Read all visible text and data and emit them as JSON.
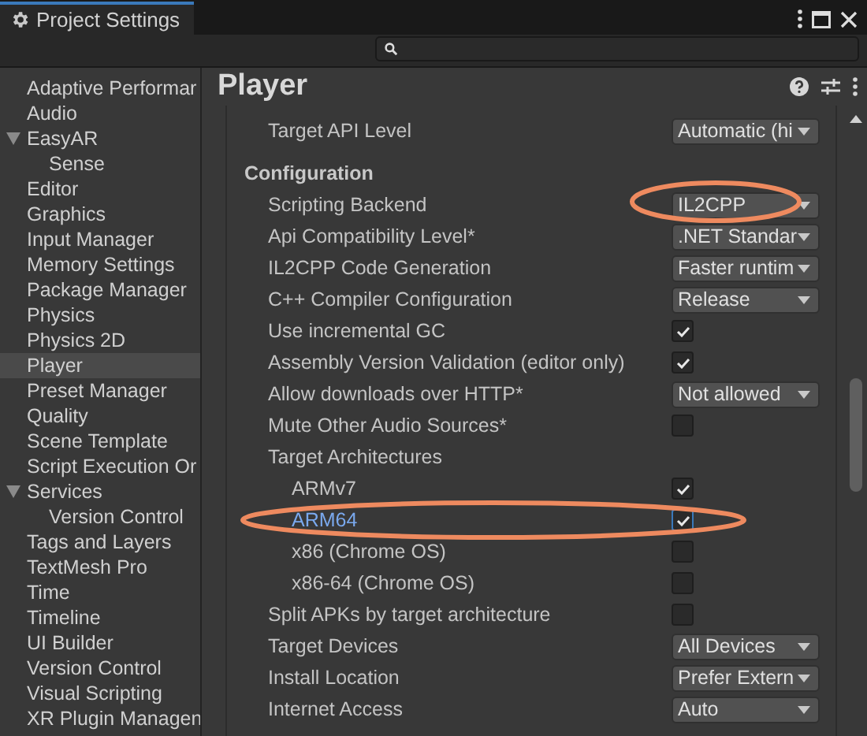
{
  "window": {
    "title": "Project Settings"
  },
  "sidebar": {
    "items": [
      {
        "label": "Adaptive Performar",
        "selected": false
      },
      {
        "label": "Audio",
        "selected": false
      },
      {
        "label": "EasyAR",
        "selected": false,
        "expanded": true,
        "children": [
          {
            "label": "Sense",
            "selected": false
          }
        ]
      },
      {
        "label": "Editor",
        "selected": false
      },
      {
        "label": "Graphics",
        "selected": false
      },
      {
        "label": "Input Manager",
        "selected": false
      },
      {
        "label": "Memory Settings",
        "selected": false
      },
      {
        "label": "Package Manager",
        "selected": false
      },
      {
        "label": "Physics",
        "selected": false
      },
      {
        "label": "Physics 2D",
        "selected": false
      },
      {
        "label": "Player",
        "selected": true
      },
      {
        "label": "Preset Manager",
        "selected": false
      },
      {
        "label": "Quality",
        "selected": false
      },
      {
        "label": "Scene Template",
        "selected": false
      },
      {
        "label": "Script Execution Or",
        "selected": false
      },
      {
        "label": "Services",
        "selected": false,
        "expanded": true,
        "children": [
          {
            "label": "Version Control",
            "selected": false
          }
        ]
      },
      {
        "label": "Tags and Layers",
        "selected": false
      },
      {
        "label": "TextMesh Pro",
        "selected": false
      },
      {
        "label": "Time",
        "selected": false
      },
      {
        "label": "Timeline",
        "selected": false
      },
      {
        "label": "UI Builder",
        "selected": false
      },
      {
        "label": "Version Control",
        "selected": false
      },
      {
        "label": "Visual Scripting",
        "selected": false
      },
      {
        "label": "XR Plugin Managen",
        "selected": false
      }
    ]
  },
  "panel": {
    "title": "Player",
    "rows": [
      {
        "kind": "dropdown",
        "label": "Target API Level",
        "value": "Automatic (hi",
        "circled": false
      },
      {
        "kind": "header",
        "label": "Configuration"
      },
      {
        "kind": "dropdown",
        "label": "Scripting Backend",
        "value": "IL2CPP",
        "circled": true
      },
      {
        "kind": "dropdown",
        "label": "Api Compatibility Level*",
        "value": ".NET Standar",
        "circled": false
      },
      {
        "kind": "dropdown",
        "label": "IL2CPP Code Generation",
        "value": "Faster runtim",
        "circled": false
      },
      {
        "kind": "dropdown",
        "label": "C++ Compiler Configuration",
        "value": "Release",
        "circled": false
      },
      {
        "kind": "checkbox",
        "label": "Use incremental GC",
        "checked": true,
        "selected": false,
        "circled": false
      },
      {
        "kind": "checkbox",
        "label": "Assembly Version Validation (editor only)",
        "checked": true,
        "selected": false,
        "circled": false
      },
      {
        "kind": "dropdown",
        "label": "Allow downloads over HTTP*",
        "value": "Not allowed",
        "circled": false
      },
      {
        "kind": "checkbox",
        "label": "Mute Other Audio Sources*",
        "checked": false,
        "selected": false,
        "circled": false
      },
      {
        "kind": "group",
        "label": "Target Architectures",
        "children": [
          {
            "kind": "checkbox",
            "label": "ARMv7",
            "checked": true,
            "selected": false,
            "circled": false
          },
          {
            "kind": "checkbox",
            "label": "ARM64",
            "checked": true,
            "selected": true,
            "circled": true
          },
          {
            "kind": "checkbox",
            "label": "x86 (Chrome OS)",
            "checked": false,
            "selected": false,
            "circled": false
          },
          {
            "kind": "checkbox",
            "label": "x86-64 (Chrome OS)",
            "checked": false,
            "selected": false,
            "circled": false
          }
        ]
      },
      {
        "kind": "checkbox",
        "label": "Split APKs by target architecture",
        "checked": false,
        "selected": false,
        "circled": false
      },
      {
        "kind": "dropdown",
        "label": "Target Devices",
        "value": "All Devices",
        "circled": false
      },
      {
        "kind": "dropdown",
        "label": "Install Location",
        "value": "Prefer Extern",
        "circled": false
      },
      {
        "kind": "dropdown",
        "label": "Internet Access",
        "value": "Auto",
        "circled": false
      }
    ]
  }
}
